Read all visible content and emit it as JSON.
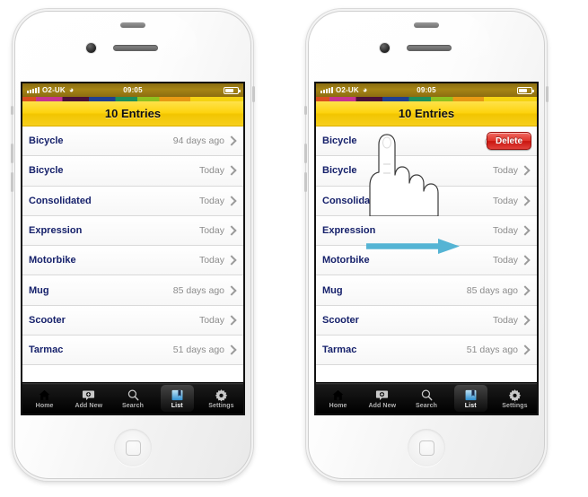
{
  "statusbar": {
    "carrier": "O2-UK",
    "wifi_icon": "wifi-icon",
    "time": "09:05",
    "signal_icon": "signal-bars-icon",
    "battery_icon": "battery-icon"
  },
  "navbar": {
    "title": "10 Entries"
  },
  "list": {
    "rows": [
      {
        "title": "Bicycle",
        "meta": "94 days ago"
      },
      {
        "title": "Bicycle",
        "meta": "Today"
      },
      {
        "title": "Consolidated",
        "meta": "Today"
      },
      {
        "title": "Expression",
        "meta": "Today"
      },
      {
        "title": "Motorbike",
        "meta": "Today"
      },
      {
        "title": "Mug",
        "meta": "85 days ago"
      },
      {
        "title": "Scooter",
        "meta": "Today"
      },
      {
        "title": "Tarmac",
        "meta": "51 days ago"
      }
    ],
    "disclosure_icon": "chevron-right-icon"
  },
  "tabbar": {
    "items": [
      {
        "label": "Home",
        "icon": "home-icon",
        "active": false
      },
      {
        "label": "Add New",
        "icon": "add-new-icon",
        "active": false
      },
      {
        "label": "Search",
        "icon": "search-icon",
        "active": false
      },
      {
        "label": "List",
        "icon": "list-icon",
        "active": true
      },
      {
        "label": "Settings",
        "icon": "gear-icon",
        "active": false
      }
    ]
  },
  "swipe": {
    "delete_label": "Delete",
    "arrow_icon": "swipe-right-arrow-icon",
    "hand_icon": "hand-swipe-icon",
    "arrow_color": "#55b4d4",
    "delete_color": "#d62b22"
  },
  "device": {
    "camera_icon": "front-camera-icon",
    "speaker_icon": "earpiece-speaker-icon",
    "home_button_icon": "home-button-icon"
  },
  "colors": {
    "navbar_yellow": "#fdd30d",
    "row_title_blue": "#16216b",
    "meta_gray": "#8c8c8c"
  }
}
